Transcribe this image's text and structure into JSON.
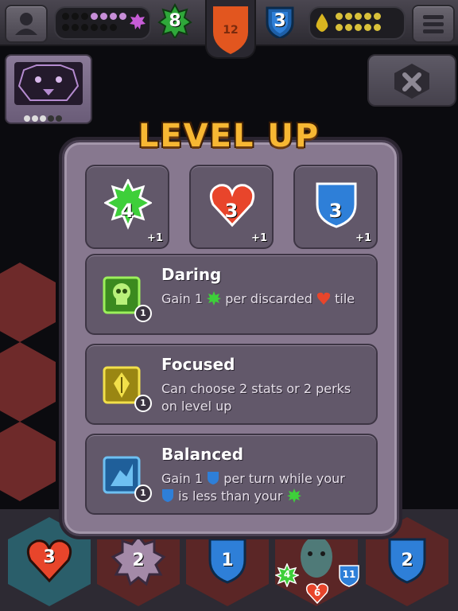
{
  "hud": {
    "player_icon": "person-icon",
    "green_badge_value": "8",
    "center_tab_value": "12",
    "blue_badge_value": "3",
    "menu_icon": "hamburger-icon"
  },
  "dialog": {
    "title": "LEVEL UP",
    "stats": [
      {
        "value": "4",
        "increment": "+1",
        "shape": "green-star",
        "color": "#3ecf3a"
      },
      {
        "value": "3",
        "increment": "+1",
        "shape": "heart",
        "color": "#e8452b"
      },
      {
        "value": "3",
        "increment": "+1",
        "shape": "blue-shield",
        "color": "#2e7fd8"
      }
    ],
    "perks": [
      {
        "name": "Daring",
        "level": "1",
        "desc_a": "Gain 1",
        "desc_b": "per discarded",
        "desc_c": "tile"
      },
      {
        "name": "Focused",
        "level": "1",
        "desc": "Can choose 2 stats or 2 perks on level up"
      },
      {
        "name": "Balanced",
        "level": "1",
        "desc_a": "Gain 1",
        "desc_b": "per turn while your",
        "desc_c": "is less than your"
      }
    ]
  },
  "board": {
    "tiles": [
      {
        "value": "3",
        "shape": "heart"
      },
      {
        "value": "2",
        "shape": "gear"
      },
      {
        "value": "1",
        "shape": "shield"
      },
      {
        "value": "",
        "shape": "zombie"
      },
      {
        "value": "2",
        "shape": "shield"
      }
    ],
    "enemy_stats": {
      "attack": "4",
      "health": "6",
      "defense": "11"
    }
  },
  "colors": {
    "dialog_bg": "#87788f",
    "panel_bg": "#62586a",
    "title_orange": "#f7b733"
  }
}
